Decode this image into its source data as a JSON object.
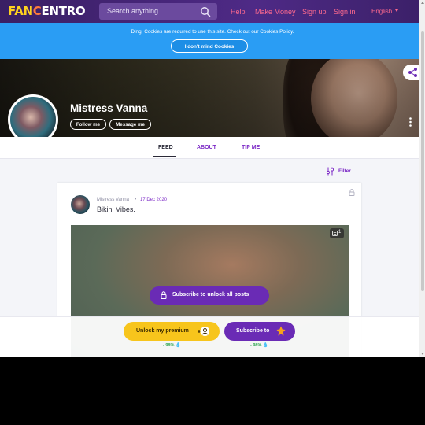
{
  "header": {
    "logo": {
      "part1": "FAN",
      "part2": "C",
      "part3": "ENTRO"
    },
    "search_placeholder": "Search anything",
    "nav": [
      "Help",
      "Make Money",
      "Sign up",
      "Sign in"
    ],
    "language": "English",
    "colors": {
      "bar": "#3f2270",
      "link": "#ff6a8e"
    }
  },
  "cookie_banner": {
    "text": "Ding! Cookies are required to use this site. Check out our Cookies Policy.",
    "button": "I don't mind Cookies",
    "color": "#2a9df4"
  },
  "profile": {
    "name": "Mistress Vanna",
    "follow_label": "Follow me",
    "message_label": "Message me"
  },
  "tabs": [
    "FEED",
    "ABOUT",
    "TIP ME"
  ],
  "active_tab": "FEED",
  "filter_label": "Filter",
  "post": {
    "author": "Mistress Vanna",
    "separator": "•",
    "date": "17 Dec 2020",
    "text": "Bikini Vibes. ",
    "media_count": "1",
    "unlock_label": "Subscribe to unlock all posts"
  },
  "cta": {
    "premium_label": "Unlock my premium",
    "premium_discount": "- 98%",
    "subscribe_label": "Subscribe to",
    "subscribe_discount": "- 98%",
    "accent": "#6a2bb5",
    "premium_color": "#f7c51c"
  },
  "icons": [
    "search-icon",
    "share-icon",
    "more-vertical-icon",
    "filter-icon",
    "lock-icon",
    "gallery-icon",
    "unlock-lock-icon",
    "premium-user-icon",
    "crown-icon",
    "drop-icon"
  ]
}
